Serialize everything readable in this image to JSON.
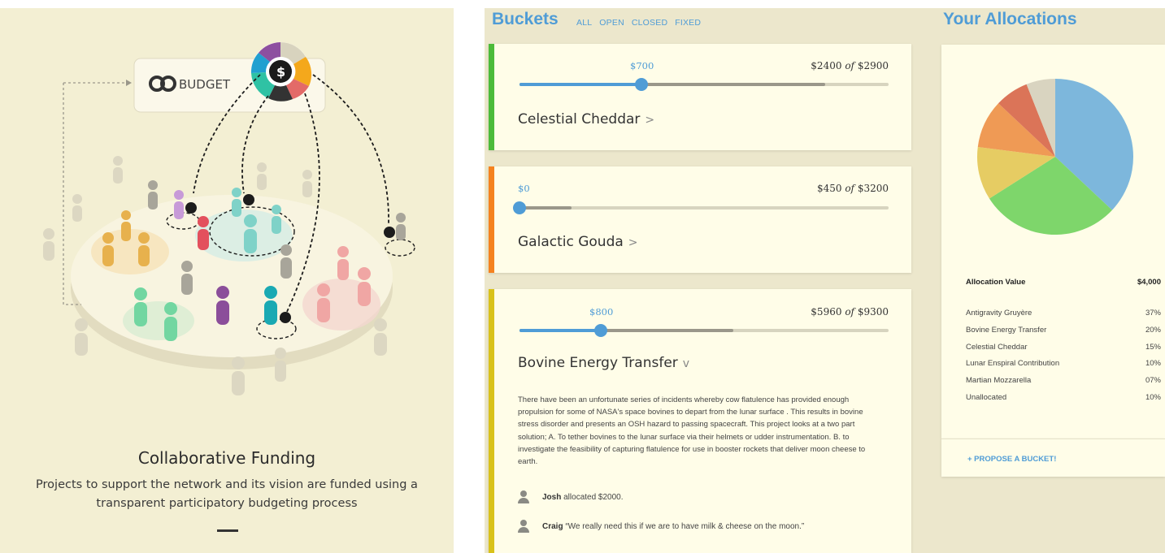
{
  "intro": {
    "logo_text": "BUDGET",
    "title": "Collaborative Funding",
    "description": "Projects to support the network and its vision are funded using a transparent participatory budgeting process"
  },
  "buckets": {
    "title": "Buckets",
    "filters": [
      "ALL",
      "OPEN",
      "CLOSED",
      "FIXED"
    ],
    "items": [
      {
        "name": "Celestial Cheddar",
        "chevron": ">",
        "allocation": "$700",
        "funded": "$2400",
        "of": "of",
        "target": "$2900",
        "funded_fraction": 0.8276,
        "allocation_fraction": 0.33,
        "color": "#4cbb3a"
      },
      {
        "name": "Galactic Gouda",
        "chevron": ">",
        "allocation": "$0",
        "funded": "$450",
        "of": "of",
        "target": "$3200",
        "funded_fraction": 0.1406,
        "allocation_fraction": 0.0,
        "color": "#f5821f"
      },
      {
        "name": "Bovine Energy Transfer",
        "chevron": "v",
        "allocation": "$800",
        "funded": "$5960",
        "of": "of",
        "target": "$9300",
        "funded_fraction": 0.5798,
        "allocation_fraction": 0.22,
        "color": "#d9c21a",
        "description": "There have been an unfortunate series of incidents whereby cow flatulence has provided enough propulsion for some of NASA's space bovines to depart from the lunar surface . This results in bovine stress disorder and presents an OSH hazard to passing spacecraft. This project looks at a two part solution; A. To tether bovines to the lunar surface via their helmets or udder instrumentation. B. to investigate the feasibility of capturing flatulence for use in booster rockets that deliver moon cheese to earth.",
        "comments": [
          {
            "author": "Josh",
            "text": "allocated $2000."
          },
          {
            "author": "Craig",
            "text": "“We really need this if we are to have milk & cheese on the moon.”"
          }
        ]
      }
    ]
  },
  "allocations": {
    "title": "Your Allocations",
    "header_label": "Allocation Value",
    "header_value": "$4,000",
    "rows": [
      {
        "name": "Antigravity Gruyère",
        "pct": "37%"
      },
      {
        "name": "Bovine Energy Transfer",
        "pct": "20%"
      },
      {
        "name": "Celestial Cheddar",
        "pct": "15%"
      },
      {
        "name": "Lunar Enspiral Contribution",
        "pct": "10%"
      },
      {
        "name": "Martian Mozzarella",
        "pct": "07%"
      },
      {
        "name": "Unallocated",
        "pct": "10%"
      }
    ],
    "propose_label": "+ PROPOSE A BUCKET!"
  },
  "chart_data": {
    "type": "pie",
    "title": "",
    "series": [
      {
        "values": [
          37,
          29,
          11,
          10,
          7,
          6
        ],
        "colors": [
          "#7db7dc",
          "#7ed66b",
          "#e6cc63",
          "#ef9a55",
          "#db7458",
          "#d9d4c0"
        ]
      }
    ]
  }
}
